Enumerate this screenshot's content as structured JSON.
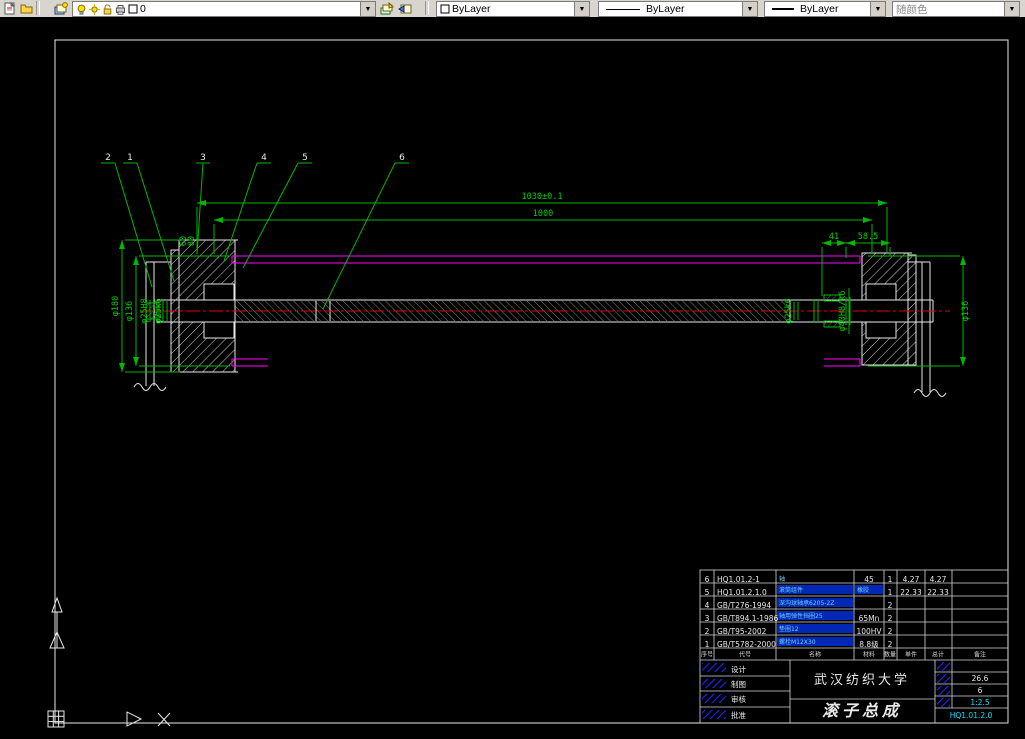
{
  "toolbar": {
    "layer": "0",
    "color": "ByLayer",
    "linetype": "ByLayer",
    "lineweight": "ByLayer",
    "plot_style": "随颜色",
    "dropdown_glyph": "▼"
  },
  "icons": {
    "document-icon": "new-sheet",
    "folder-icon": "open",
    "layers-icon": "layer-properties-manager",
    "lightbulb-icon": "layer-on",
    "sun-icon": "layer-thawed",
    "lock-icon": "layer-unlocked",
    "printer-icon": "layer-plot",
    "color-swatch-icon": "layer-color",
    "layer-current-icon": "make-object-layer-current",
    "layer-previous-icon": "layer-previous",
    "dropdown-arrow-icon": "▼"
  },
  "drawing": {
    "callouts": [
      "2",
      "1",
      "3",
      "4",
      "5",
      "6"
    ],
    "dims": {
      "overall": "1030±0.1",
      "length": "1000",
      "a41": "41",
      "a585": "58.5",
      "cap60": "60",
      "cap80": "80",
      "dia180": "φ180",
      "dia136_left": "φ136",
      "fit25h8": "φ25H8",
      "fit25k6": "φ25k6",
      "fit25k6_right": "φ25k6",
      "fit40h8": "φ40H8/k6",
      "dia136_right": "φ136"
    }
  },
  "title_block": {
    "parts_header": {
      "no": "序号",
      "code": "代号",
      "name": "名称",
      "material": "材料",
      "qty": "数量",
      "unit": "单件",
      "total": "总计",
      "remark": "备注"
    },
    "parts": [
      {
        "no": "6",
        "code": "HQ1.01.2-1",
        "name": "轴",
        "material": "45",
        "qty": "1",
        "unit": "4.27",
        "total": "4.27"
      },
      {
        "no": "5",
        "code": "HQ1.01.2.1.0",
        "name": "滚筒组件",
        "material": "橡胶",
        "qty": "1",
        "unit": "22.33",
        "total": "22.33"
      },
      {
        "no": "4",
        "code": "GB/T276-1994",
        "name": "深沟球轴承6205-2Z",
        "material": "",
        "qty": "2",
        "unit": "",
        "total": ""
      },
      {
        "no": "3",
        "code": "GB/T894.1-1986",
        "name": "轴用弹性挡圈25",
        "material": "65Mn",
        "qty": "2",
        "unit": "",
        "total": ""
      },
      {
        "no": "2",
        "code": "GB/T95-2002",
        "name": "垫圈12",
        "material": "100HV",
        "qty": "2",
        "unit": "",
        "total": ""
      },
      {
        "no": "1",
        "code": "GB/T5782-2000",
        "name": "螺栓M12X30",
        "material": "8.8级",
        "qty": "2",
        "unit": "",
        "total": ""
      }
    ],
    "sign_rows": [
      "设计",
      "制图",
      "审核",
      "批准"
    ],
    "university": "武汉纺织大学",
    "product": "滚子总成",
    "weight": "26.6",
    "sheets": "6",
    "scale": "1:2.5",
    "code": "HQ1.01.2.0"
  }
}
